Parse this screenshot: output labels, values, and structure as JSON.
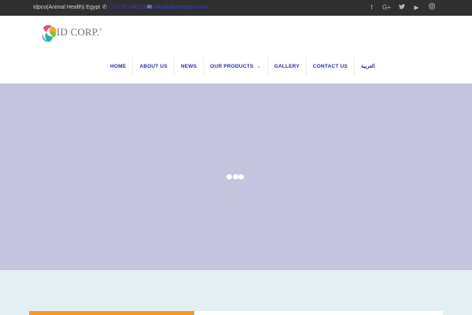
{
  "topbar": {
    "company": "Idpco(Animal Health) Egypt",
    "phone_icon": "phone-icon",
    "phone": "(+2) 02 24512588",
    "mail_icon": "mail-icon",
    "email": "info@idpcoegypt.com",
    "social": [
      {
        "name": "facebook-icon",
        "glyph": "f"
      },
      {
        "name": "google-plus-icon",
        "glyph": "G+"
      },
      {
        "name": "twitter-icon",
        "glyph": "🐦"
      },
      {
        "name": "youtube-icon",
        "glyph": "▶"
      },
      {
        "name": "instagram-icon",
        "glyph": "◎"
      }
    ]
  },
  "header": {
    "logo_text": "ID CORP.",
    "logo_registered": "®"
  },
  "nav": {
    "items": [
      {
        "label": "HOME"
      },
      {
        "label": "ABOUT US"
      },
      {
        "label": "NEWS"
      },
      {
        "label": "OUR PRODUCTS",
        "chevron": "⌄"
      },
      {
        "label": "GALLERY"
      },
      {
        "label": "CONTACT US"
      },
      {
        "label": "العربية"
      }
    ]
  },
  "colors": {
    "topbar_bg": "#2f2f2f",
    "nav_text": "#2b2ba8",
    "hero_bg": "#c4c4de",
    "bottom_bg": "#e3eff3",
    "accent_orange": "#f39a2b"
  }
}
